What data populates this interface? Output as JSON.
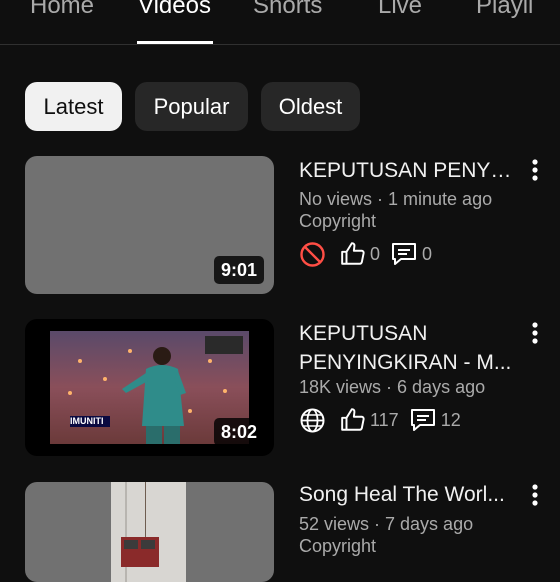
{
  "tabs": [
    "Home",
    "Videos",
    "Shorts",
    "Live",
    "Playli"
  ],
  "chips": [
    "Latest",
    "Popular",
    "Oldest"
  ],
  "videos": [
    {
      "title": "KEPUTUSAN PENYI...",
      "meta": "No views · 1 minute ago",
      "copyright": "Copyright",
      "likes": "0",
      "comments": "0",
      "duration": "9:01",
      "visibility_icon": "blocked-icon"
    },
    {
      "title_line1": "KEPUTUSAN",
      "title_line2": "PENYINGKIRAN - M...",
      "meta": "18K views · 6 days ago",
      "likes": "117",
      "comments": "12",
      "duration": "8:02",
      "thumb_badge": "IMUNITI",
      "visibility_icon": "globe-icon"
    },
    {
      "title": "Song Heal The Worl...",
      "meta": "52 views · 7 days ago",
      "copyright": "Copyright"
    }
  ]
}
